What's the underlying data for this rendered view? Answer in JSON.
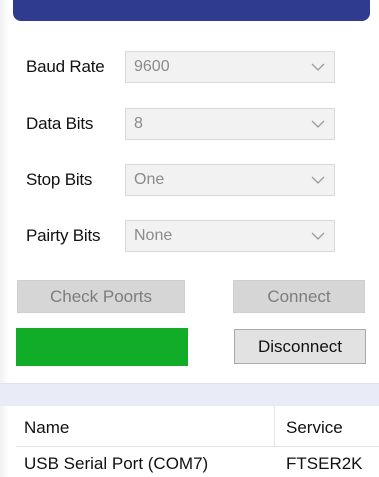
{
  "settings": {
    "baud_rate": {
      "label": "Baud Rate",
      "value": "9600"
    },
    "data_bits": {
      "label": "Data Bits",
      "value": "8"
    },
    "stop_bits": {
      "label": "Stop Bits",
      "value": "One"
    },
    "parity_bits": {
      "label": "Pairty Bits",
      "value": "None"
    }
  },
  "buttons": {
    "check_ports": "Check Poorts",
    "connect": "Connect",
    "disconnect": "Disconnect"
  },
  "status": {
    "color": "#11ad28"
  },
  "ports_list": {
    "columns": [
      "Name",
      "Service"
    ],
    "rows": [
      {
        "name": "USB Serial Port (COM7)",
        "service": "FTSER2K"
      }
    ]
  },
  "colors": {
    "title_bar": "#2f3b8f",
    "combo_bg": "#f2f2f2",
    "status_green": "#11ad28"
  },
  "icons": {
    "combo_arrow": "chevron-down-icon"
  }
}
